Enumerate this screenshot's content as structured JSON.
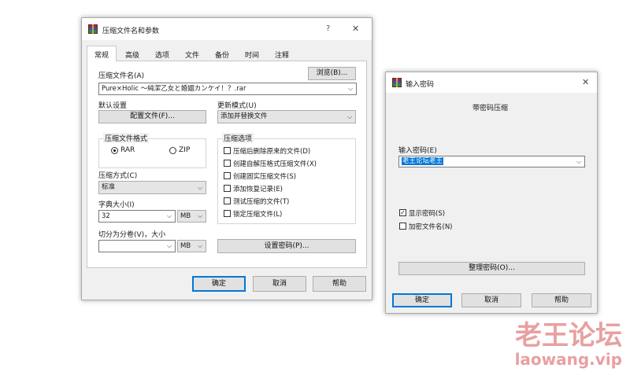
{
  "left_dialog": {
    "title": "压缩文件名和参数",
    "help_glyph": "?",
    "close_glyph": "✕",
    "tabs": [
      "常规",
      "高级",
      "选项",
      "文件",
      "备份",
      "时间",
      "注释"
    ],
    "archive_name_label": "压缩文件名(A)",
    "browse_button": "浏览(B)...",
    "archive_name_value": "Pure×Holic ～純潔乙女と婚姻カンケイ！？.rar",
    "default_settings_label": "默认设置",
    "profiles_button": "配置文件(F)...",
    "update_mode_label": "更新模式(U)",
    "update_mode_value": "添加并替换文件",
    "format_group": "压缩文件格式",
    "format_rar": "RAR",
    "format_zip": "ZIP",
    "method_label": "压缩方式(C)",
    "method_value": "标准",
    "dict_label": "字典大小(I)",
    "dict_value": "32",
    "dict_unit": "MB",
    "split_label": "切分为分卷(V)，大小",
    "split_value": "",
    "split_unit": "MB",
    "options_group": "压缩选项",
    "options": [
      {
        "label": "压缩后删除原来的文件(D)",
        "checked": false
      },
      {
        "label": "创建自解压格式压缩文件(X)",
        "checked": false
      },
      {
        "label": "创建固实压缩文件(S)",
        "checked": false
      },
      {
        "label": "添加恢复记录(E)",
        "checked": false
      },
      {
        "label": "测试压缩的文件(T)",
        "checked": false
      },
      {
        "label": "锁定压缩文件(L)",
        "checked": false
      }
    ],
    "set_password_button": "设置密码(P)...",
    "ok_button": "确定",
    "cancel_button": "取消",
    "help_button": "帮助"
  },
  "right_dialog": {
    "title": "输入密码",
    "close_glyph": "✕",
    "heading": "带密码压缩",
    "password_label": "输入密码(E)",
    "password_value": "老王论坛老王",
    "show_password": {
      "label": "显示密码(S)",
      "checked": true
    },
    "encrypt_names": {
      "label": "加密文件名(N)",
      "checked": false
    },
    "organize_button": "整理密码(O)...",
    "ok_button": "确定",
    "cancel_button": "取消",
    "help_button": "帮助"
  },
  "watermark": {
    "line1": "老王论坛",
    "line2": "laowang.vip",
    "color": "#e8a0a0"
  },
  "colors": {
    "accent": "#0078d7",
    "selection": "#0078d7"
  }
}
